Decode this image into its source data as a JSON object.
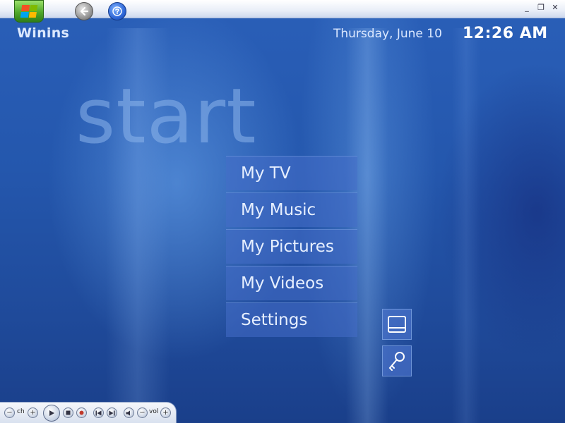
{
  "titlebar": {
    "controls": [
      "_",
      "❐",
      "✕"
    ]
  },
  "header": {
    "app_name": "Winins",
    "date": "Thursday, June 10",
    "time": "12:26 AM"
  },
  "page": {
    "title_word": "start"
  },
  "menu": {
    "items": [
      {
        "label": "My TV"
      },
      {
        "label": "My Music"
      },
      {
        "label": "My Pictures"
      },
      {
        "label": "My Videos"
      },
      {
        "label": "Settings"
      }
    ]
  },
  "transport": {
    "ch_label": "ch",
    "vol_label": "vol",
    "minus": "−",
    "plus": "+"
  }
}
